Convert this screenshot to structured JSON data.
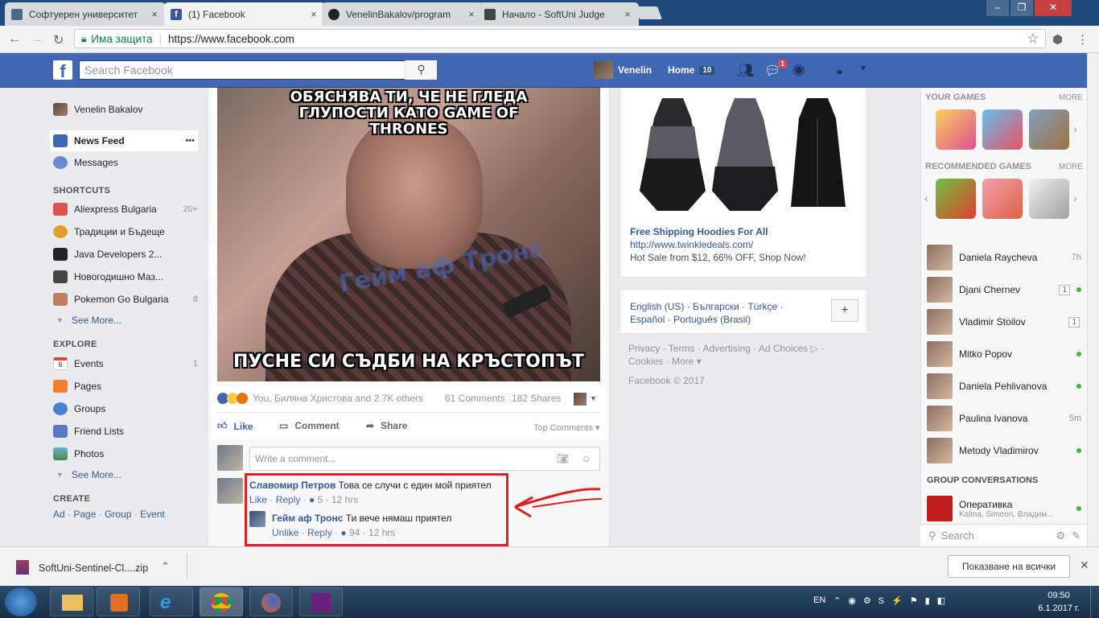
{
  "browser": {
    "tabs": [
      {
        "label": "Софтуерен университет",
        "icon_color": "#4a6a8a"
      },
      {
        "label": "(1) Facebook",
        "icon_color": "#3b5998"
      },
      {
        "label": "VenelinBakalov/program",
        "icon_color": "#222222"
      },
      {
        "label": "Начало - SoftUni Judge",
        "icon_color": "#444444"
      }
    ],
    "close_glyph": "×",
    "address": {
      "secure_label": "Има защита",
      "url": "https://www.facebook.com"
    }
  },
  "fb_header": {
    "logo": "f",
    "search_placeholder": "Search Facebook",
    "user_name": "Venelin",
    "home_label": "Home",
    "home_count": "10",
    "messages_badge": "1"
  },
  "left_nav": {
    "profile_name": "Venelin Bakalov",
    "news_feed": "News Feed",
    "more_dots": "•••",
    "messages": "Messages",
    "shortcuts_title": "SHORTCUTS",
    "shortcuts": [
      {
        "label": "Aliexpress Bulgaria",
        "count": "20+"
      },
      {
        "label": "Традиции и Бъдеще",
        "count": ""
      },
      {
        "label": "Java Developers 2...",
        "count": ""
      },
      {
        "label": "Новогодишно Маз...",
        "count": ""
      },
      {
        "label": "Pokemon Go Bulgaria",
        "count": "8"
      }
    ],
    "see_more": "See More...",
    "explore_title": "EXPLORE",
    "explore": [
      {
        "label": "Events",
        "count": "1"
      },
      {
        "label": "Pages",
        "count": ""
      },
      {
        "label": "Groups",
        "count": ""
      },
      {
        "label": "Friend Lists",
        "count": ""
      },
      {
        "label": "Photos",
        "count": ""
      }
    ],
    "events_day": "6",
    "create_title": "CREATE",
    "create_links": [
      "Ad",
      "Page",
      "Group",
      "Event"
    ],
    "create_sep": "·"
  },
  "post": {
    "meme_top": "ОБЯСНЯВА ТИ, ЧЕ НЕ ГЛЕДА ГЛУПОСТИ КАТО GAME OF THRONES",
    "meme_bottom": "ПУСНЕ СИ СЪДБИ НА КРЪСТОПЪТ",
    "watermark": "Гейм аф Тронс",
    "reactions_text": "You, Биляна Христова and 2.7K others",
    "comments_count": "61 Comments",
    "shares_count": "182 Shares",
    "like_label": "Like",
    "comment_label": "Comment",
    "share_label": "Share",
    "top_comments": "Top Comments ▾",
    "comment_placeholder": "Write a comment...",
    "comments": [
      {
        "name": "Славомир Петров",
        "text": "Това се случи с един мой приятел",
        "action": "Like",
        "reply": "Reply",
        "likes": "5",
        "time": "12 hrs"
      },
      {
        "name": "Гейм аф Тронс",
        "text": "Ти вече нямаш приятел",
        "action": "Unlike",
        "reply": "Reply",
        "likes": "94",
        "time": "12 hrs"
      }
    ],
    "highlight_color": "#e02020"
  },
  "ad": {
    "title": "Free Shipping Hoodies For All",
    "url": "http://www.twinkledeals.com/",
    "desc": "Hot Sale from $12, 66% OFF, Shop Now!"
  },
  "languages": {
    "line1": "English (US) · Български · Türkçe ·",
    "line2": "Español · Português (Brasil)",
    "plus": "+"
  },
  "footer": {
    "line1": "Privacy · Terms · Advertising · Ad Choices ▷ ·",
    "line2": "Cookies · More ▾",
    "copyright": "Facebook © 2017"
  },
  "chat": {
    "your_games": "YOUR GAMES",
    "recommended_games": "RECOMMENDED GAMES",
    "more": "MORE",
    "friends": [
      {
        "name": "Daniela Raycheva",
        "status": "7h",
        "online": false,
        "unread": ""
      },
      {
        "name": "Djani Chernev",
        "status": "",
        "online": true,
        "unread": "1"
      },
      {
        "name": "Vladimir Stoilov",
        "status": "",
        "online": false,
        "unread": "1"
      },
      {
        "name": "Mitko Popov",
        "status": "",
        "online": true,
        "unread": ""
      },
      {
        "name": "Daniela Pehlivanova",
        "status": "",
        "online": true,
        "unread": ""
      },
      {
        "name": "Paulina Ivanova",
        "status": "5m",
        "online": false,
        "unread": ""
      },
      {
        "name": "Metody Vladimirov",
        "status": "",
        "online": true,
        "unread": ""
      }
    ],
    "group_title": "GROUP CONVERSATIONS",
    "group": {
      "name": "Оперативка",
      "members": "Kalina, Simeon, Владим..."
    },
    "search_placeholder": "Search"
  },
  "downloads": {
    "file": "SoftUni-Sentinel-Cl....zip",
    "show_all": "Показване на всички"
  },
  "taskbar": {
    "lang": "EN",
    "time": "09:50",
    "date": "6.1.2017 г."
  }
}
